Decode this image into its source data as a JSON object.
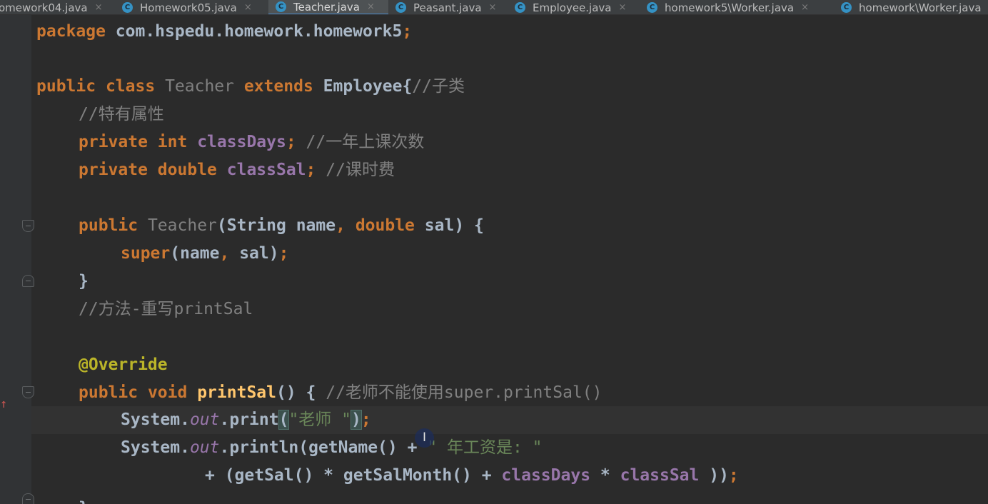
{
  "tabs": [
    {
      "label": "omework04.java",
      "active": false,
      "has_icon": false
    },
    {
      "label": "Homework05.java",
      "active": false,
      "has_icon": true
    },
    {
      "label": "Teacher.java",
      "active": true,
      "has_icon": true
    },
    {
      "label": "Peasant.java",
      "active": false,
      "has_icon": true
    },
    {
      "label": "Employee.java",
      "active": false,
      "has_icon": true
    },
    {
      "label": "homework5\\Worker.java",
      "active": false,
      "has_icon": true
    },
    {
      "label": "homework\\Worker.java",
      "active": false,
      "has_icon": true
    }
  ],
  "tab_icon_glyph": "C",
  "tab_close_glyph": "×",
  "editor": {
    "package_kw": "package",
    "package_name": " com.hspedu.homework.homework5",
    "class_decl": {
      "public": "public",
      "class": "class",
      "name": "Teacher",
      "extends": "extends",
      "parent": "Employee",
      "brace": "{",
      "comment": "//子类"
    },
    "comment_fields": "//特有属性",
    "field1": {
      "mod": "private",
      "type": "int",
      "name": "classDays",
      "comment": "//一年上课次数"
    },
    "field2": {
      "mod": "private",
      "type": "double",
      "name": "classSal",
      "comment": "//课时费"
    },
    "ctor": {
      "public": "public",
      "name": "Teacher",
      "open": "(",
      "type1": "String",
      "arg1": "name",
      "type2": "double",
      "arg2": "sal",
      "tail": ") {"
    },
    "super_call": {
      "kw": "super",
      "args": "(name",
      "args2": " sal)"
    },
    "close_brace": "}",
    "comment_method": "//方法-重写printSal",
    "annotation": "@Override",
    "method": {
      "public": "public",
      "void": "void",
      "name": "printSal",
      "parens": "() {",
      "comment": "//老师不能使用super.printSal()"
    },
    "print_line": {
      "system": "System.",
      "out": "out",
      "dot": ".",
      "call": "print",
      "open": "(",
      "str": "\"老师 \"",
      "close": ")"
    },
    "println_line": {
      "system": "System.",
      "out": "out",
      "call": ".println(getName() + ",
      "str": "\" 年工资是: \""
    },
    "continuation": {
      "lead": "+ (getSal() * getSalMonth() + ",
      "f1": "classDays",
      "mid": " * ",
      "f2": "classSal",
      "tail": " ))"
    },
    "last_brace": "}",
    "semicolon": ";",
    "comma": ","
  },
  "cursor_glyph": "I",
  "gutter_marker": "↑",
  "colors": {
    "background": "#2b2b2b",
    "keyword": "#cc7832",
    "field": "#9876aa",
    "method": "#ffc66d",
    "annotation": "#bbb529",
    "string": "#6a8759",
    "comment": "#808080",
    "active_tab_underline": "#4a88c7"
  }
}
